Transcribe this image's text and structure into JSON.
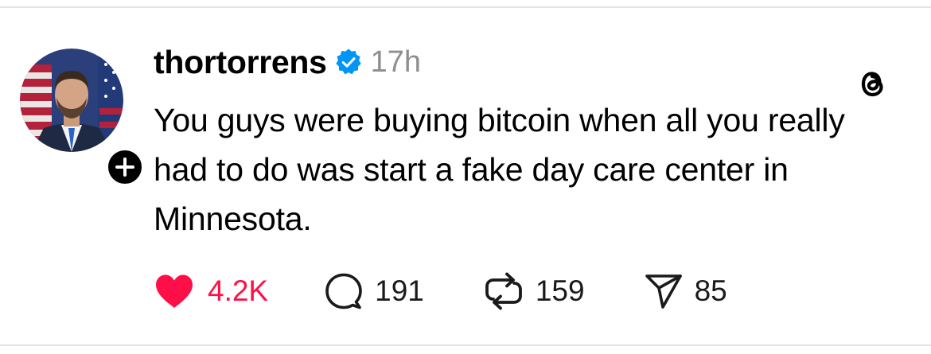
{
  "post": {
    "username": "thortorrens",
    "verified": true,
    "timestamp": "17h",
    "text": "You guys were buying bitcoin when all you really had to do was start a fake day care center in Minnesota."
  },
  "actions": {
    "like_count": "4.2K",
    "comment_count": "191",
    "repost_count": "159",
    "share_count": "85"
  },
  "colors": {
    "like_red": "#ff0f47",
    "verified_blue": "#0095f6",
    "timestamp_gray": "#8e8e8e"
  },
  "icons": {
    "like": "heart-filled-icon",
    "comment": "speech-bubble-icon",
    "repost": "repost-icon",
    "share": "paper-plane-icon",
    "app": "threads-logo-icon",
    "verified": "verified-badge-icon",
    "follow": "plus-icon"
  }
}
